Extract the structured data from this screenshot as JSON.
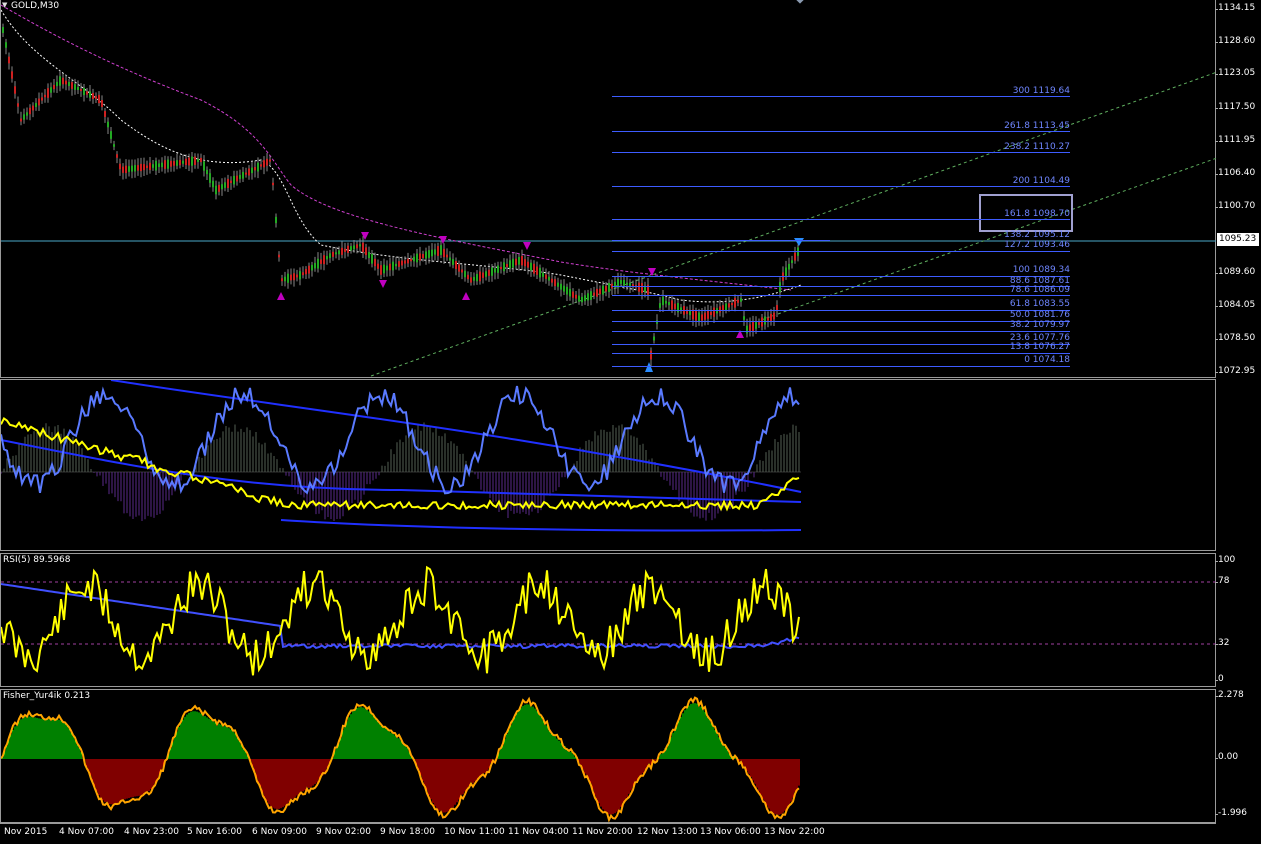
{
  "chart": {
    "symbol_label": "GOLD,M30",
    "current_price": "1095.23"
  },
  "price_axis": [
    "1134.15",
    "1128.60",
    "1123.05",
    "1117.50",
    "1111.95",
    "1106.40",
    "1100.70",
    "1095.23",
    "1089.60",
    "1084.05",
    "1078.50",
    "1072.95"
  ],
  "fib_levels": [
    {
      "label": "300 1119.64"
    },
    {
      "label": "261.8 1113.45"
    },
    {
      "label": "238.2 1110.27"
    },
    {
      "label": "200 1104.49"
    },
    {
      "label": "161.8 1098.70"
    },
    {
      "label": "138.2 1095.12"
    },
    {
      "label": "127.2 1093.46"
    },
    {
      "label": "100 1089.34"
    },
    {
      "label": "88.6 1087.61"
    },
    {
      "label": "78.6 1086.09"
    },
    {
      "label": "61.8 1083.55"
    },
    {
      "label": "50.0 1081.76"
    },
    {
      "label": "38.2 1079.97"
    },
    {
      "label": "23.6 1077.76"
    },
    {
      "label": "13.8 1076.27"
    },
    {
      "label": "0 1074.18"
    }
  ],
  "rsi_panel": {
    "title": "RSI(5) 89.5968",
    "axis": [
      "100",
      "78",
      "32",
      "0"
    ]
  },
  "fisher_panel": {
    "title": "Fisher_Yur4ik 0.213",
    "axis": [
      "2.278",
      "0.00",
      "-1.996"
    ]
  },
  "time_axis": [
    "Nov 2015",
    "4 Nov 07:00",
    "4 Nov 23:00",
    "5 Nov 16:00",
    "6 Nov 09:00",
    "9 Nov 02:00",
    "9 Nov 18:00",
    "10 Nov 11:00",
    "11 Nov 04:00",
    "11 Nov 20:00",
    "12 Nov 13:00",
    "13 Nov 06:00",
    "13 Nov 22:00"
  ],
  "colors": {
    "background": "#000000",
    "fib": "#3d5cff",
    "rsi": "#ffff00",
    "fisher_up": "#00ff00",
    "fisher_down": "#ff0000",
    "arrow": "#c000c0",
    "arrow_blue": "#2a8cff"
  }
}
